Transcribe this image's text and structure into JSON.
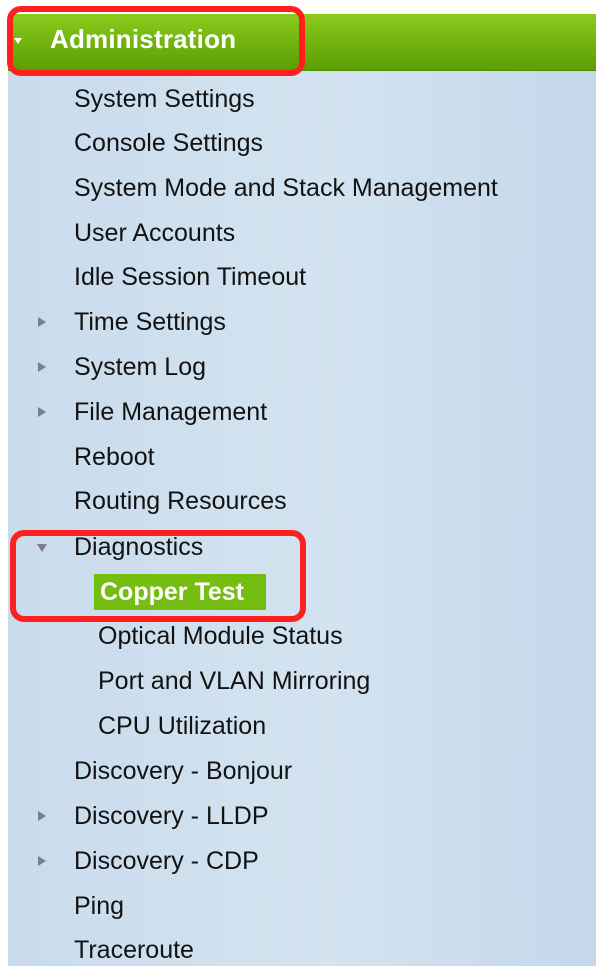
{
  "header": {
    "label": "Administration"
  },
  "menu": {
    "items": [
      {
        "label": "System Settings"
      },
      {
        "label": "Console Settings"
      },
      {
        "label": "System Mode and Stack Management"
      },
      {
        "label": "User Accounts"
      },
      {
        "label": "Idle Session Timeout"
      },
      {
        "label": "Time Settings",
        "expander": "collapsed"
      },
      {
        "label": "System Log",
        "expander": "collapsed"
      },
      {
        "label": "File Management",
        "expander": "collapsed"
      },
      {
        "label": "Reboot"
      },
      {
        "label": "Routing Resources"
      },
      {
        "label": "Diagnostics",
        "expander": "expanded"
      },
      {
        "label": "Discovery - Bonjour"
      },
      {
        "label": "Discovery - LLDP",
        "expander": "collapsed"
      },
      {
        "label": "Discovery - CDP",
        "expander": "collapsed"
      },
      {
        "label": "Ping"
      },
      {
        "label": "Traceroute"
      }
    ],
    "diagnostics_children": [
      {
        "label": "Copper Test",
        "selected": true
      },
      {
        "label": "Optical Module Status"
      },
      {
        "label": "Port and VLAN Mirroring"
      },
      {
        "label": "CPU Utilization"
      }
    ]
  },
  "colors": {
    "header_green": "#6fb20d",
    "selected_green": "#76bd12",
    "panel_blue": "#d3e3f0",
    "highlight_red": "#ff1f1f"
  }
}
